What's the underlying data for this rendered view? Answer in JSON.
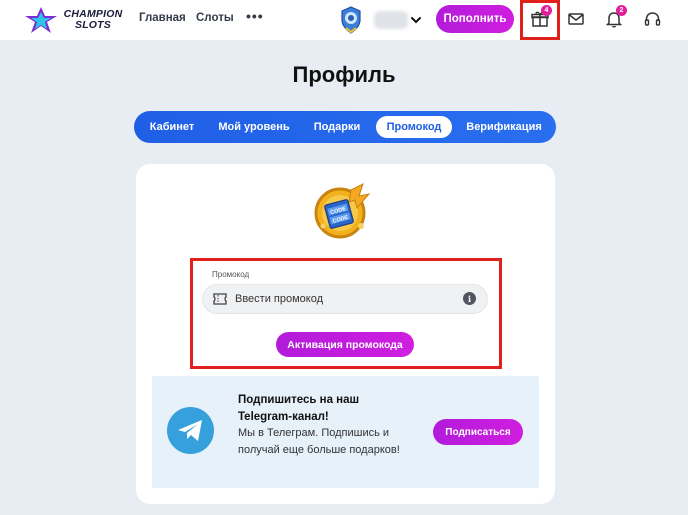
{
  "header": {
    "logo_line1": "CHAMPION",
    "logo_line2": "SLOTS",
    "nav": [
      {
        "label": "Главная"
      },
      {
        "label": "Слоты"
      }
    ],
    "more_label": "•••",
    "deposit_label": "Пополнить",
    "gift_badge": "4",
    "notifications_badge": "2"
  },
  "page": {
    "title": "Профиль"
  },
  "tabs": [
    {
      "label": "Кабинет",
      "active": false
    },
    {
      "label": "Мой уровень",
      "active": false
    },
    {
      "label": "Подарки",
      "active": false
    },
    {
      "label": "Промокод",
      "active": true
    },
    {
      "label": "Верификация",
      "active": false
    }
  ],
  "promo": {
    "field_label": "Промокод",
    "input_placeholder": "Ввести промокод",
    "activate_label": "Активация промокода",
    "coin_text_top": "CODE",
    "coin_text_mid": "CODE"
  },
  "telegram": {
    "title": "Подпишитесь на наш Telegram-канал!",
    "text": "Мы в Телеграм. Подпишись и получай еще больше подарков!",
    "button_label": "Подписаться"
  },
  "colors": {
    "accent_magenta": "#c11cdd",
    "tab_blue": "#2266ea",
    "highlight_red": "#e0201a",
    "telegram_blue": "#36a0dd"
  }
}
